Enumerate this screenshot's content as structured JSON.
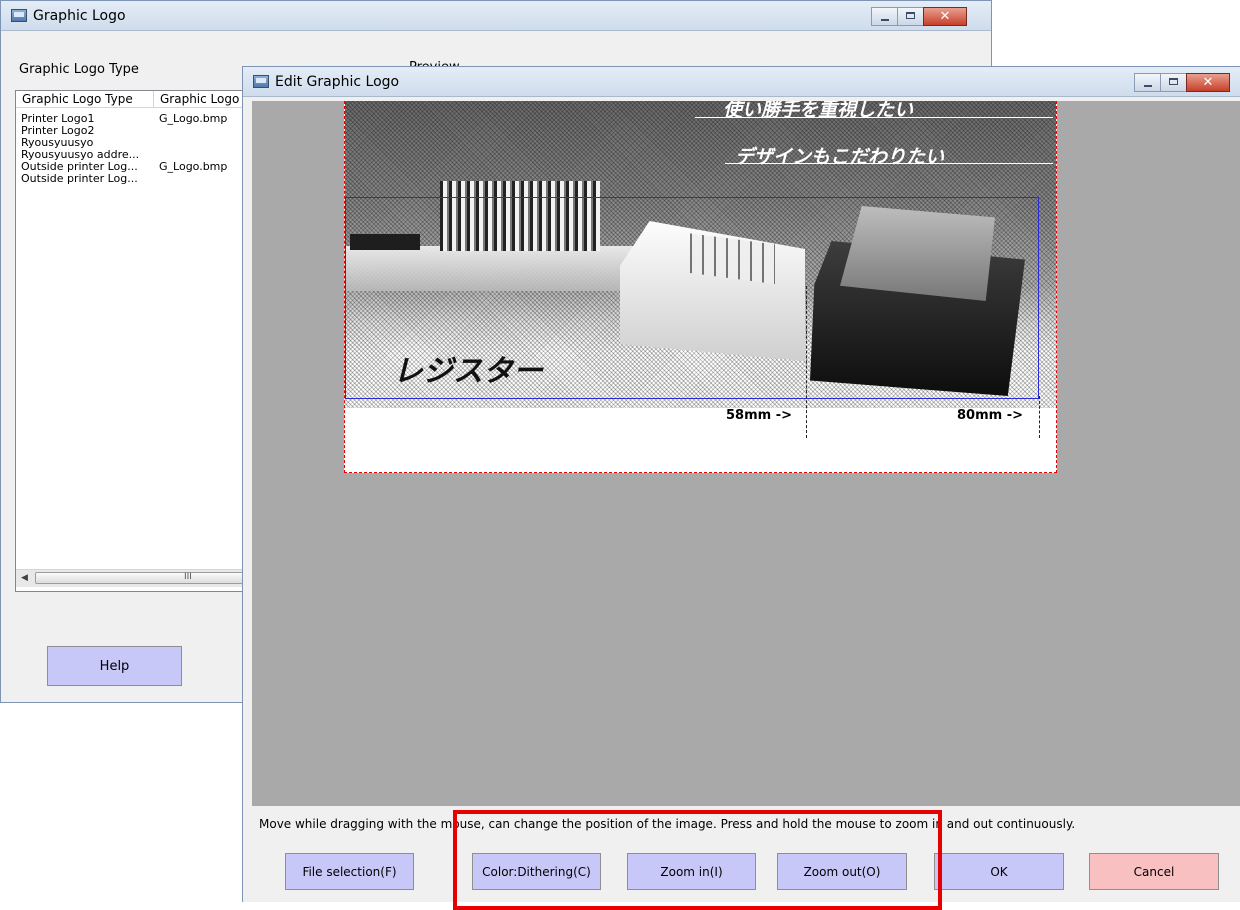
{
  "main_window": {
    "title": "Graphic Logo",
    "type_label": "Graphic Logo Type",
    "preview_label": "Preview",
    "columns": [
      "Graphic Logo Type",
      "Graphic Logo"
    ],
    "rows": [
      {
        "type": "Printer Logo1",
        "file": "G_Logo.bmp"
      },
      {
        "type": "Printer Logo2",
        "file": ""
      },
      {
        "type": "Ryousyuusyo",
        "file": ""
      },
      {
        "type": "Ryousyuusyo addre...",
        "file": ""
      },
      {
        "type": "Outside printer Log...",
        "file": "G_Logo.bmp"
      },
      {
        "type": "Outside printer Log...",
        "file": ""
      }
    ],
    "scroll_grip": "III",
    "help_label": "Help"
  },
  "edit_window": {
    "title": "Edit Graphic Logo",
    "image_text": {
      "line1": "使い勝手を重視したい",
      "line2": "デザインもこだわりたい",
      "register": "レジスター"
    },
    "marker_58": "58mm ->",
    "marker_80": "80mm ->",
    "hint": "Move while dragging with the mouse, can change the position of the image. Press and hold the mouse to zoom in and out continuously.",
    "buttons": {
      "file_selection": "File selection(F)",
      "color": "Color:Dithering(C)",
      "zoom_in": "Zoom in(I)",
      "zoom_out": "Zoom out(O)",
      "ok": "OK",
      "cancel": "Cancel"
    }
  },
  "colors": {
    "button_blue": "#c8c8f8",
    "button_cancel": "#f8c0c0",
    "canvas_gray": "#a9a9a9",
    "highlight_red": "#e60000",
    "crop_blue": "#2b2bd6"
  }
}
